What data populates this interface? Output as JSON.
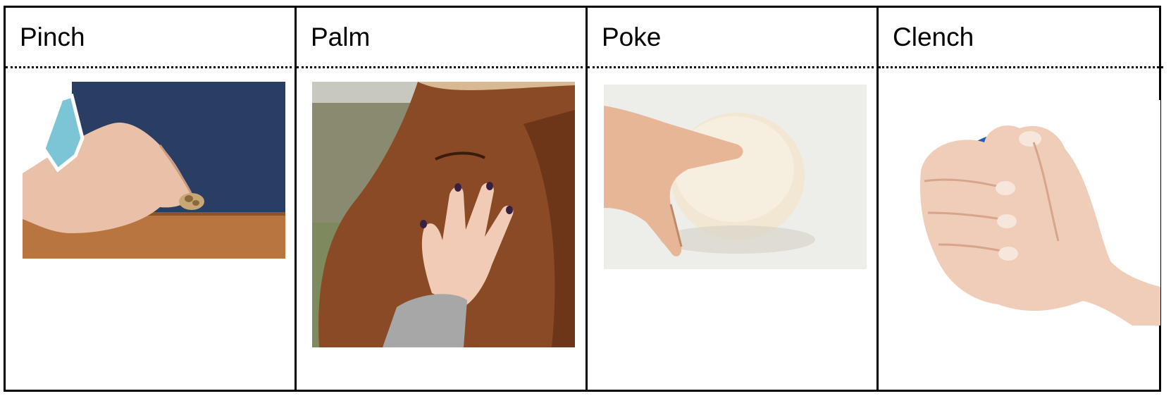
{
  "columns": [
    {
      "label": "Pinch",
      "image": "hand-pinching-small-object-photo"
    },
    {
      "label": "Palm",
      "image": "hand-palm-on-horse-face-photo"
    },
    {
      "label": "Poke",
      "image": "finger-poking-dough-photo"
    },
    {
      "label": "Clench",
      "image": "hand-squeezing-globe-stress-ball-photo"
    }
  ]
}
